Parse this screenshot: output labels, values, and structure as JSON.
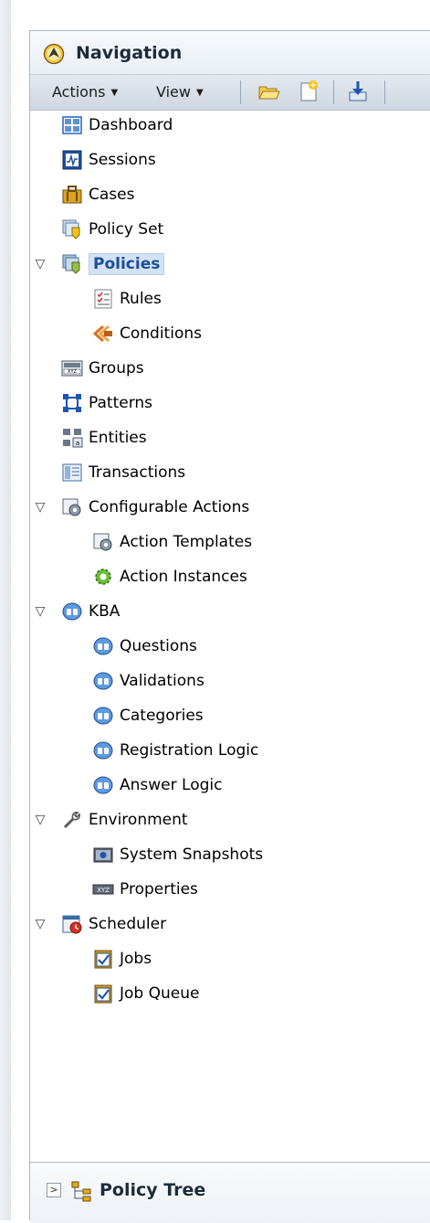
{
  "header": {
    "title": "Navigation",
    "icon": "navigation-compass-icon"
  },
  "toolbar": {
    "actions_label": "Actions",
    "view_label": "View",
    "open_icon": "folder-open-icon",
    "new_icon": "new-item-icon",
    "import_icon": "download-icon"
  },
  "tree": [
    {
      "label": "Dashboard",
      "icon": "dashboard-icon"
    },
    {
      "label": "Sessions",
      "icon": "sessions-icon"
    },
    {
      "label": "Cases",
      "icon": "briefcase-icon"
    },
    {
      "label": "Policy Set",
      "icon": "policy-set-icon"
    },
    {
      "label": "Policies",
      "icon": "policies-icon",
      "expanded": true,
      "selected": true
    },
    {
      "label": "Rules",
      "icon": "rules-icon"
    },
    {
      "label": "Conditions",
      "icon": "conditions-icon"
    },
    {
      "label": "Groups",
      "icon": "groups-icon"
    },
    {
      "label": "Patterns",
      "icon": "patterns-icon"
    },
    {
      "label": "Entities",
      "icon": "entities-icon"
    },
    {
      "label": "Transactions",
      "icon": "transactions-icon"
    },
    {
      "label": "Configurable Actions",
      "icon": "configurable-actions-icon",
      "expanded": true
    },
    {
      "label": "Action Templates",
      "icon": "action-templates-icon"
    },
    {
      "label": "Action Instances",
      "icon": "action-instances-icon"
    },
    {
      "label": "KBA",
      "icon": "kba-icon",
      "expanded": true
    },
    {
      "label": "Questions",
      "icon": "kba-icon"
    },
    {
      "label": "Validations",
      "icon": "kba-icon"
    },
    {
      "label": "Categories",
      "icon": "kba-icon"
    },
    {
      "label": "Registration Logic",
      "icon": "kba-icon"
    },
    {
      "label": "Answer Logic",
      "icon": "kba-icon"
    },
    {
      "label": "Environment",
      "icon": "wrench-icon",
      "expanded": true
    },
    {
      "label": "System Snapshots",
      "icon": "snapshot-icon"
    },
    {
      "label": "Properties",
      "icon": "properties-icon"
    },
    {
      "label": "Scheduler",
      "icon": "scheduler-icon",
      "expanded": true
    },
    {
      "label": "Jobs",
      "icon": "jobs-icon"
    },
    {
      "label": "Job Queue",
      "icon": "job-queue-icon"
    }
  ],
  "footer": {
    "title": "Policy Tree",
    "icon": "policy-tree-icon",
    "disclosure": "collapsed"
  },
  "colors": {
    "selection_bg": "#d3e2f4",
    "selection_text": "#1b4f9c",
    "header_bg": "#e9eff5"
  }
}
